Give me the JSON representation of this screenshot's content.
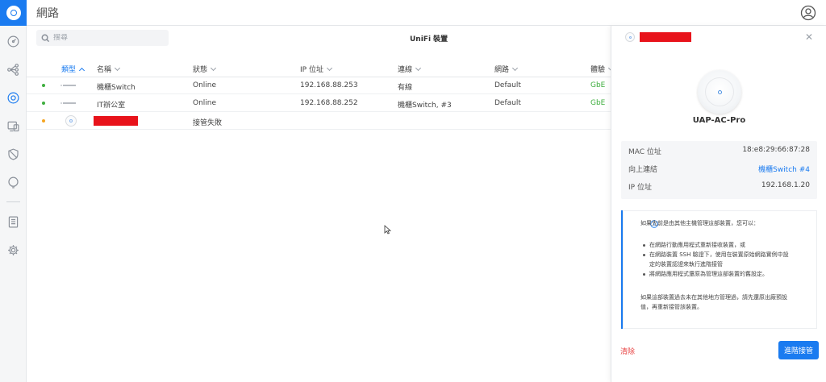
{
  "app": {
    "title": "網路"
  },
  "search": {
    "placeholder": "搜尋"
  },
  "list": {
    "title": "UniFi 裝置",
    "columns": [
      "類型",
      "名稱",
      "狀態",
      "IP 位址",
      "連線",
      "網路",
      "體驗"
    ],
    "rows": [
      {
        "status_color": "#3fae3f",
        "type_icon": "switch-icon",
        "name": "機櫃Switch",
        "state": "Online",
        "ip": "192.168.88.253",
        "uplink": "有線",
        "network": "Default",
        "experience": "GbE"
      },
      {
        "status_color": "#3fae3f",
        "type_icon": "switch-icon",
        "name": "IT辦公室",
        "state": "Online",
        "ip": "192.168.88.252",
        "uplink": "機櫃Switch, #3",
        "network": "Default",
        "experience": "GbE"
      },
      {
        "status_color": "#f5a623",
        "type_icon": "access-point-icon",
        "name": "",
        "state": "接管失敗",
        "ip": "",
        "uplink": "",
        "network": "",
        "experience": ""
      }
    ]
  },
  "panel": {
    "model": "UAP-AC-Pro",
    "properties": [
      {
        "key": "MAC 位址",
        "value": "18:e8:29:66:87:28"
      },
      {
        "key": "向上連結",
        "value": "機櫃Switch #4"
      },
      {
        "key": "IP 位址",
        "value": "192.168.1.20"
      }
    ],
    "notice": {
      "intro": "如果先前是由其他主機管理這部裝置，您可以：",
      "bullets": [
        "在網路行動應用程式重新接收裝置，或",
        "在網路裝置 SSH 驗證下，使用在裝置原始網路實例中設",
        "定的裝置認證來執行進階接管",
        "將網路應用程式還原為管理這部裝置的舊設定。"
      ],
      "footer": [
        "如果這部裝置過去未在其他地方管理過，請先還原出廠預設",
        "值，再重新接管該裝置。"
      ]
    },
    "clear_label": "清除",
    "adopt_label": "進階接管"
  },
  "colors": {
    "accent": "#1a7bf0",
    "online": "#3fae3f",
    "warning": "#f5a623",
    "danger": "#e84444",
    "redaction": "#e8131b"
  }
}
